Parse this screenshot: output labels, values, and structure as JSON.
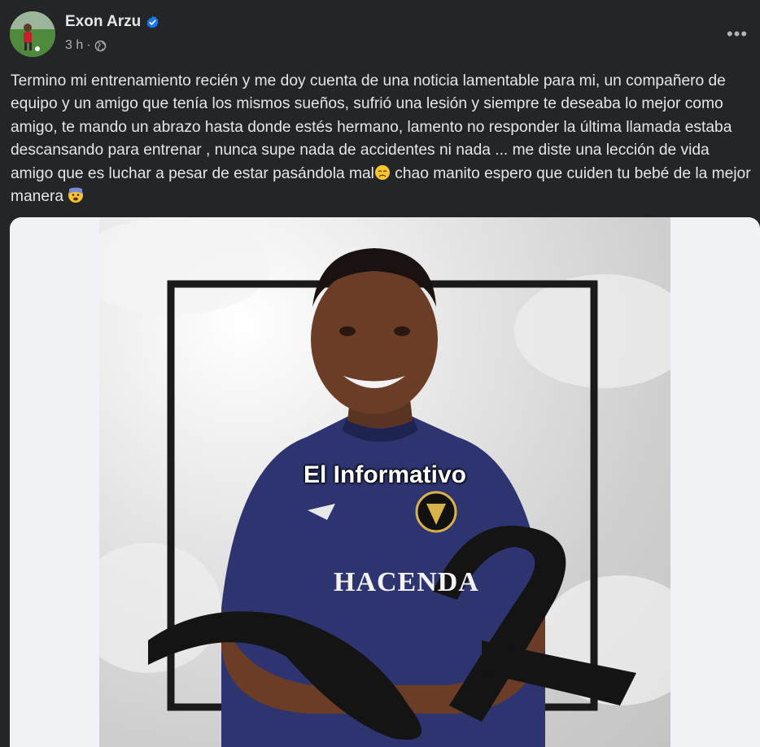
{
  "post": {
    "author": "Exon Arzu",
    "timestamp": "3 h",
    "separator": "·",
    "more_label": "•••",
    "text": "Termino mi entrenamiento recién y me doy cuenta de una noticia lamentable para mi, un compañero de equipo y un amigo que tenía los mismos sueños, sufrió una lesión y siempre te deseaba lo mejor como amigo, te mando un abrazo hasta donde estés hermano, lamento no responder la última llamada estaba descansando para entrenar , nunca supe nada de accidentes ni nada ... me diste una lección de vida amigo que es luchar a pesar de estar pasándola mal",
    "text_end_1": " chao manito espero que cuiden tu bebé de la mejor manera ",
    "emoji_1": "disappointed-face",
    "emoji_2": "fearful-face"
  },
  "image": {
    "watermark": "El Informativo",
    "jersey_text": "HACENDA",
    "subject": "photo-of-player-with-black-mourning-ribbon"
  },
  "colors": {
    "background": "#242526",
    "text_primary": "#e4e6eb",
    "text_secondary": "#b0b3b8",
    "verified_blue": "#1877f2"
  }
}
